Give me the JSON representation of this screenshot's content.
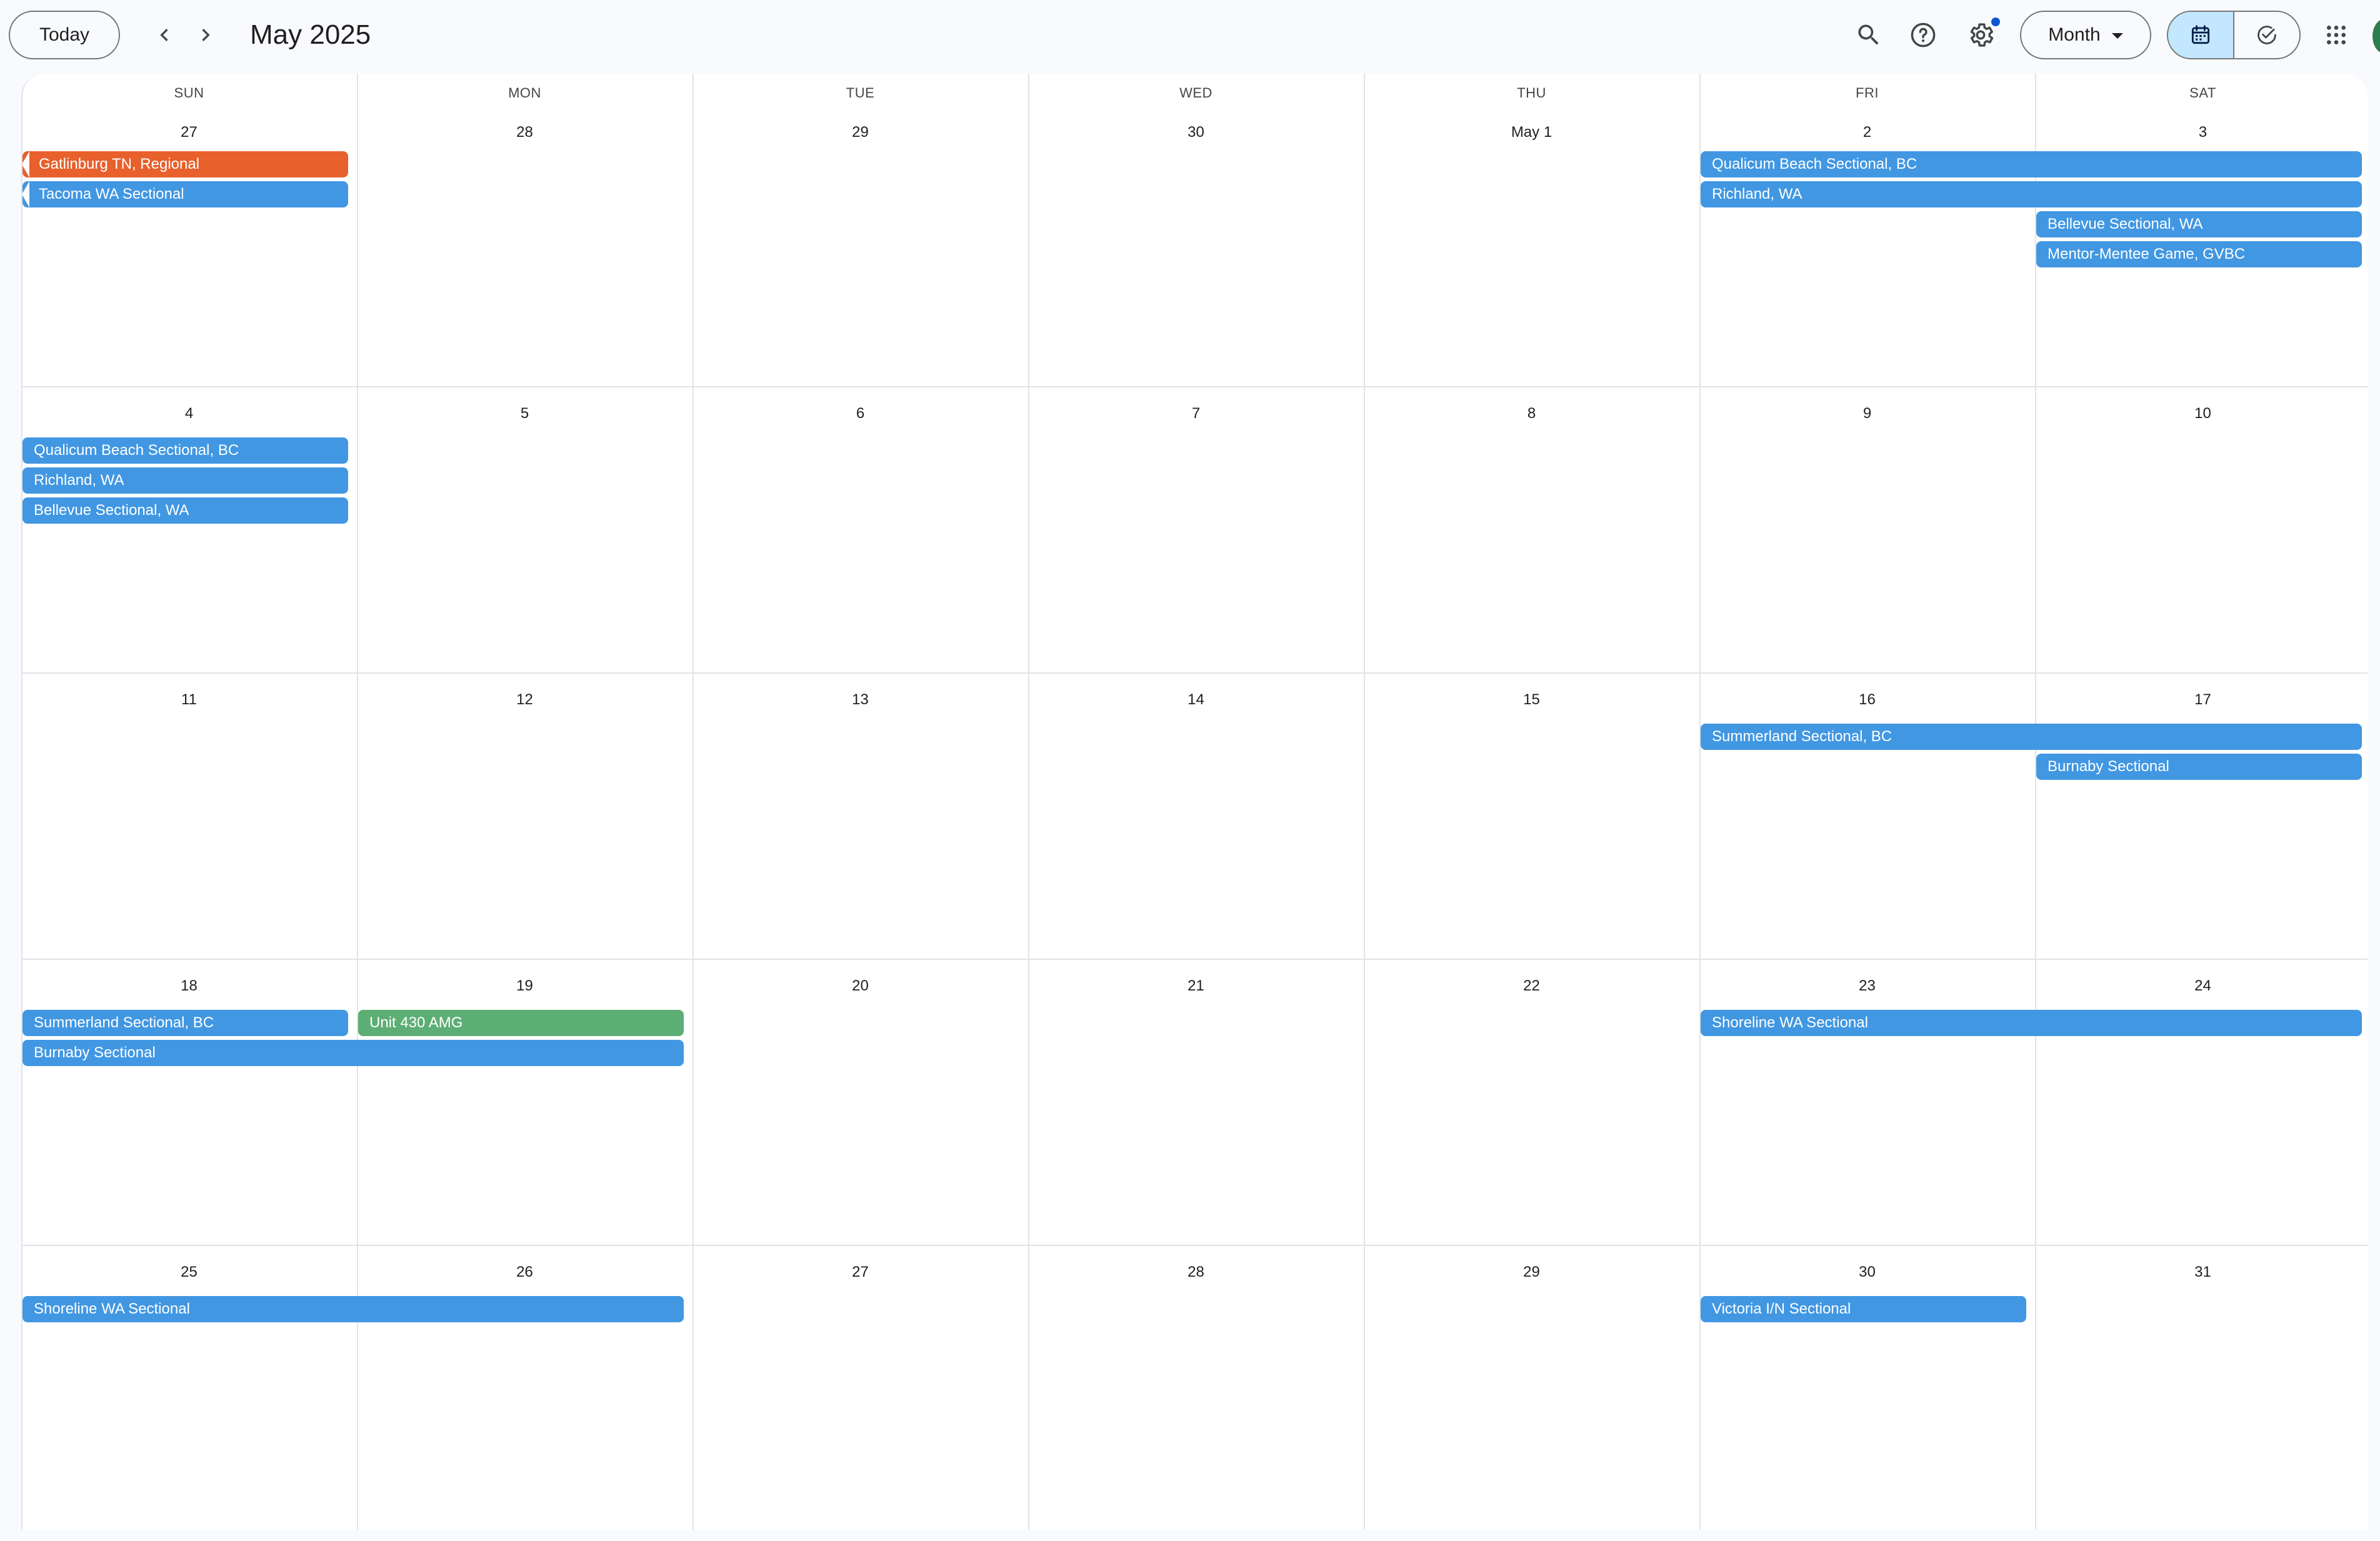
{
  "header": {
    "today_label": "Today",
    "month_title": "May 2025",
    "view_label": "Month",
    "icons": [
      "chevron-left-icon",
      "chevron-right-icon",
      "search-icon",
      "help-icon",
      "gear-icon",
      "calendar-icon",
      "task-check-icon",
      "apps-grid-icon"
    ]
  },
  "weekdays": [
    "SUN",
    "MON",
    "TUE",
    "WED",
    "THU",
    "FRI",
    "SAT"
  ],
  "weeks": [
    [
      "27",
      "28",
      "29",
      "30",
      "May 1",
      "2",
      "3"
    ],
    [
      "4",
      "5",
      "6",
      "7",
      "8",
      "9",
      "10"
    ],
    [
      "11",
      "12",
      "13",
      "14",
      "15",
      "16",
      "17"
    ],
    [
      "18",
      "19",
      "20",
      "21",
      "22",
      "23",
      "24"
    ],
    [
      "25",
      "26",
      "27",
      "28",
      "29",
      "30",
      "31"
    ]
  ],
  "events": [
    {
      "title": "Gatlinburg TN, Regional",
      "week": 0,
      "start": 0,
      "span": 1,
      "lane": 0,
      "color": "#e8602c",
      "continued": true
    },
    {
      "title": "Tacoma WA Sectional",
      "week": 0,
      "start": 0,
      "span": 1,
      "lane": 1,
      "color": "#4197e2",
      "continued": true
    },
    {
      "title": "Qualicum Beach Sectional, BC",
      "week": 0,
      "start": 5,
      "span": 2,
      "lane": 0,
      "color": "#4197e2"
    },
    {
      "title": "Richland, WA",
      "week": 0,
      "start": 5,
      "span": 2,
      "lane": 1,
      "color": "#4197e2"
    },
    {
      "title": "Bellevue Sectional, WA",
      "week": 0,
      "start": 6,
      "span": 1,
      "lane": 2,
      "color": "#4197e2"
    },
    {
      "title": "Mentor-Mentee Game, GVBC",
      "week": 0,
      "start": 6,
      "span": 1,
      "lane": 3,
      "color": "#4197e2"
    },
    {
      "title": "Qualicum Beach Sectional, BC",
      "week": 1,
      "start": 0,
      "span": 1,
      "lane": 0,
      "color": "#4197e2"
    },
    {
      "title": "Richland, WA",
      "week": 1,
      "start": 0,
      "span": 1,
      "lane": 1,
      "color": "#4197e2"
    },
    {
      "title": "Bellevue Sectional, WA",
      "week": 1,
      "start": 0,
      "span": 1,
      "lane": 2,
      "color": "#4197e2"
    },
    {
      "title": "Summerland Sectional, BC",
      "week": 2,
      "start": 5,
      "span": 2,
      "lane": 0,
      "color": "#4197e2"
    },
    {
      "title": "Burnaby Sectional",
      "week": 2,
      "start": 6,
      "span": 1,
      "lane": 1,
      "color": "#4197e2"
    },
    {
      "title": "Summerland Sectional, BC",
      "week": 3,
      "start": 0,
      "span": 1,
      "lane": 0,
      "color": "#4197e2"
    },
    {
      "title": "Unit 430 AMG",
      "week": 3,
      "start": 1,
      "span": 1,
      "lane": 0,
      "color": "#5dae75"
    },
    {
      "title": "Burnaby Sectional",
      "week": 3,
      "start": 0,
      "span": 2,
      "lane": 1,
      "color": "#4197e2"
    },
    {
      "title": "Shoreline WA Sectional",
      "week": 3,
      "start": 5,
      "span": 2,
      "lane": 0,
      "color": "#4197e2"
    },
    {
      "title": "Shoreline WA Sectional",
      "week": 4,
      "start": 0,
      "span": 2,
      "lane": 0,
      "color": "#4197e2"
    },
    {
      "title": "Victoria I/N Sectional",
      "week": 4,
      "start": 5,
      "span": 1,
      "lane": 0,
      "color": "#4197e2"
    }
  ]
}
